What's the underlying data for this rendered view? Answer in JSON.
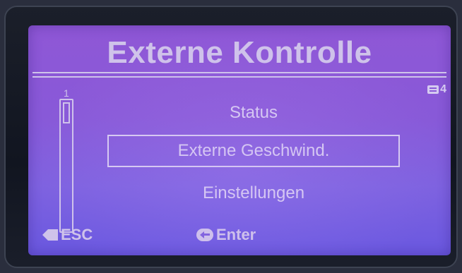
{
  "screen": {
    "title": "Externe Kontrolle",
    "page_indicator": "4",
    "scroll_position_label": "1"
  },
  "menu": {
    "items": [
      {
        "label": "Status",
        "selected": false
      },
      {
        "label": "Externe Geschwind.",
        "selected": true
      },
      {
        "label": "Einstellungen",
        "selected": false
      }
    ]
  },
  "softkeys": {
    "left_label": "ESC",
    "center_label": "Enter"
  },
  "colors": {
    "lcd_background": "#8859d8",
    "lcd_text": "#cfc3ea",
    "bezel": "#111520"
  },
  "icons": {
    "page": "page-list-icon",
    "esc": "back-arrow-icon",
    "enter": "enter-return-icon"
  }
}
